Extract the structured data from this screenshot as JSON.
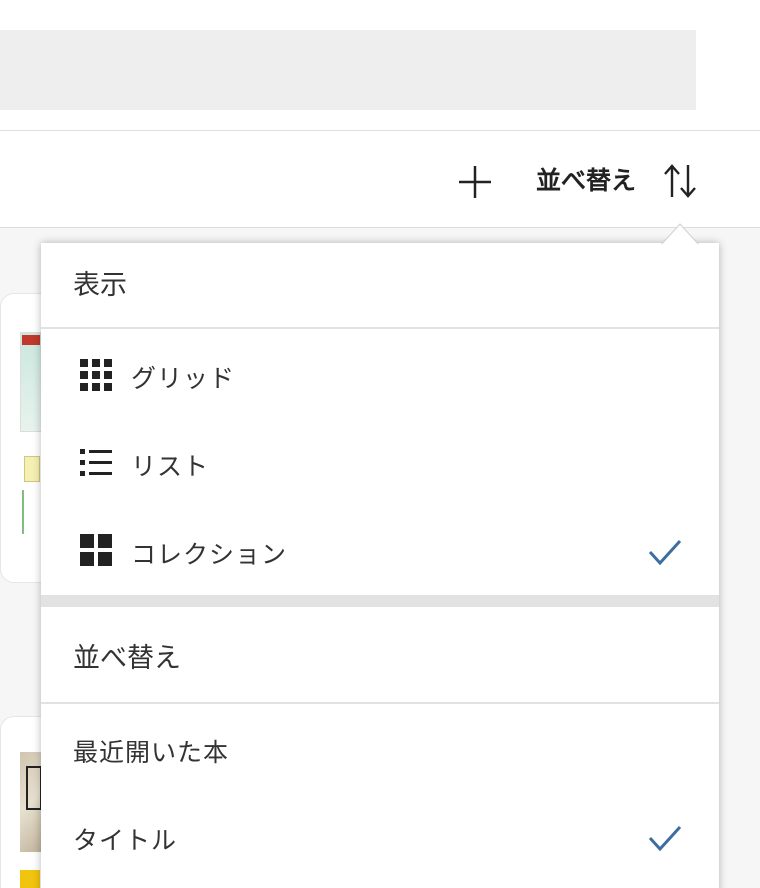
{
  "toolbar": {
    "sort_label": "並べ替え",
    "add_icon": "plus-icon",
    "sort_icon": "sort-arrows-icon"
  },
  "menu": {
    "view_header": "表示",
    "view_items": [
      {
        "label": "グリッド",
        "icon": "grid-icon",
        "selected": false
      },
      {
        "label": "リスト",
        "icon": "list-icon",
        "selected": false
      },
      {
        "label": "コレクション",
        "icon": "collection-icon",
        "selected": true
      }
    ],
    "sort_header": "並べ替え",
    "sort_items": [
      {
        "label": "最近開いた本",
        "selected": false
      },
      {
        "label": "タイトル",
        "selected": true
      }
    ]
  },
  "colors": {
    "check": "#3c6e9f",
    "separator": "#e2e2e2",
    "search_bar": "#eeeeee"
  }
}
